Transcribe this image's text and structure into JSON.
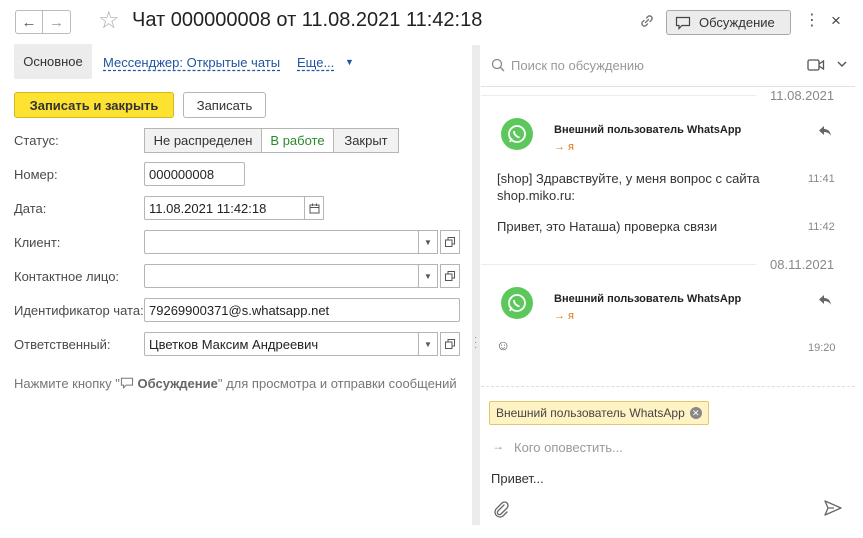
{
  "header": {
    "back_icon": "←",
    "forward_icon": "→",
    "title": "Чат 000000008 от 11.08.2021 11:42:18",
    "discussion_label": "Обсуждение",
    "more_icon": "⋮",
    "close_icon": "×"
  },
  "tabs": {
    "main": "Основное",
    "messenger": "Мессенджер: Открытые чаты",
    "more": "Еще..."
  },
  "toolbar": {
    "save_close": "Записать и закрыть",
    "save": "Записать"
  },
  "form": {
    "status_label": "Статус:",
    "status_options": [
      "Не распределен",
      "В работе",
      "Закрыт"
    ],
    "status_selected": "В работе",
    "number_label": "Номер:",
    "number_value": "000000008",
    "date_label": "Дата:",
    "date_value": "11.08.2021 11:42:18",
    "client_label": "Клиент:",
    "client_value": "",
    "contact_label": "Контактное лицо:",
    "contact_value": "",
    "chat_id_label": "Идентификатор чата:",
    "chat_id_value": "79269900371@s.whatsapp.net",
    "responsible_label": "Ответственный:",
    "responsible_value": "Цветков Максим Андреевич",
    "hint_prefix": "Нажмите кнопку \"",
    "hint_bold": "Обсуждение",
    "hint_suffix": "\" для просмотра и отправки сообщений"
  },
  "discussion": {
    "search_placeholder": "Поиск по обсуждению",
    "groups": [
      {
        "date": "11.08.2021",
        "sender": "Внешний пользователь WhatsApp",
        "to": "→ я",
        "messages": [
          {
            "text": "[shop] Здравствуйте, у меня вопрос с сайта shop.miko.ru:",
            "time": "11:41"
          },
          {
            "text": "Привет, это Наташа) проверка связи",
            "time": "11:42"
          }
        ]
      },
      {
        "date": "08.11.2021",
        "sender": "Внешний пользователь WhatsApp",
        "to": "→ я",
        "messages": [
          {
            "text": "☺",
            "time": "19:20"
          }
        ]
      }
    ],
    "recipient_chip": "Внешний пользователь WhatsApp",
    "notify_placeholder": "Кого оповестить...",
    "input_value": "Привет..."
  }
}
